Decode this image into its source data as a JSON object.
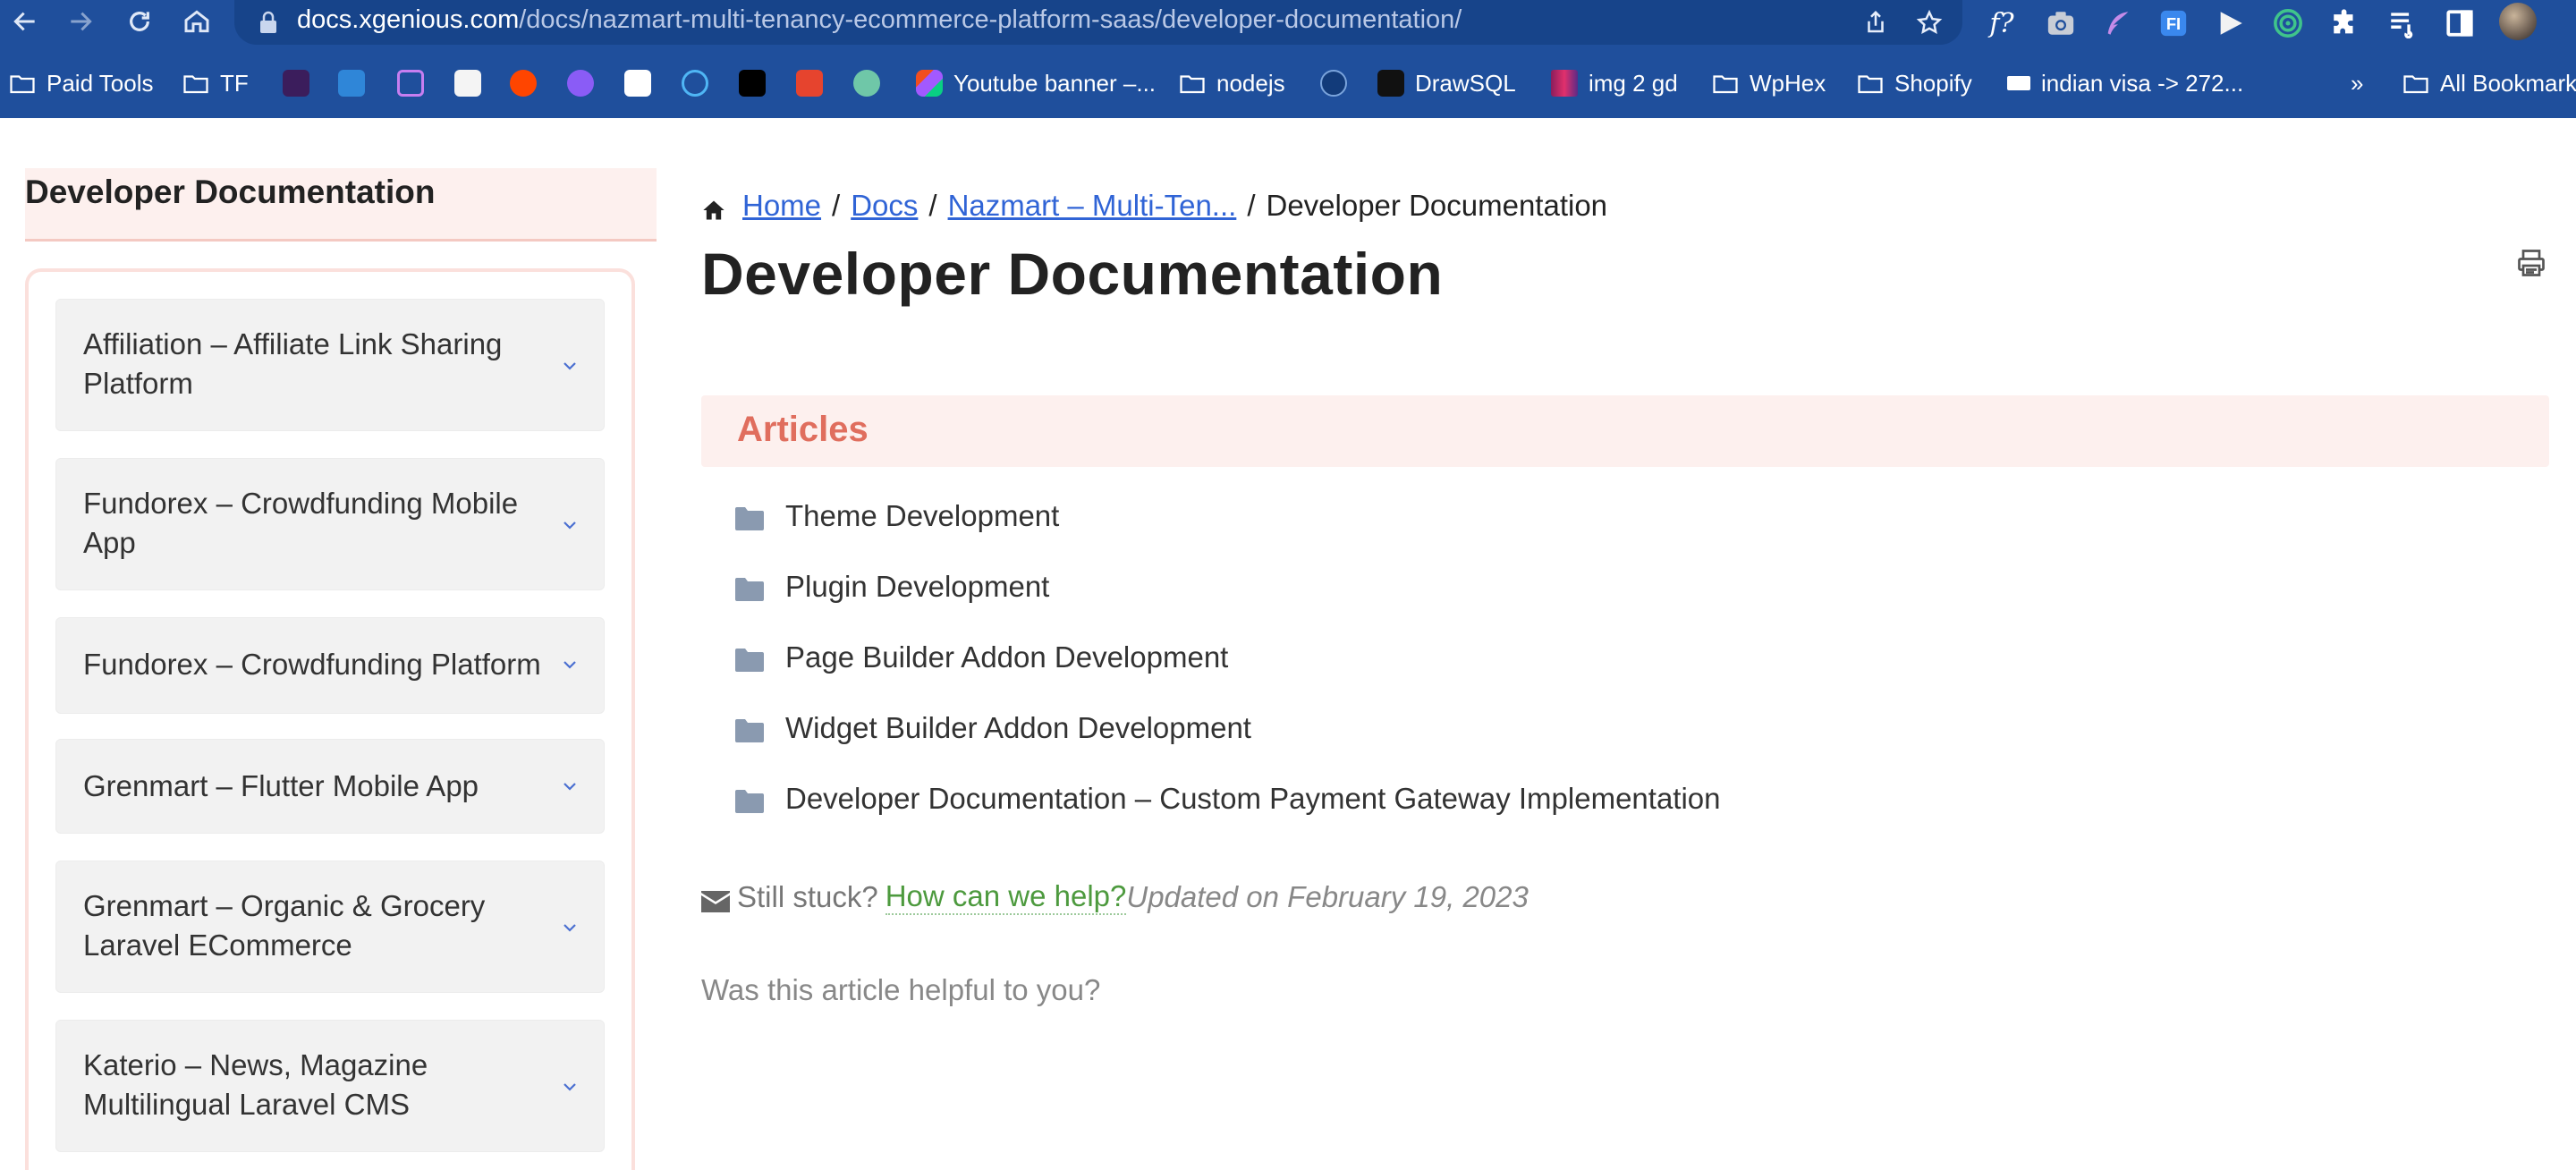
{
  "browser": {
    "url_host": "docs.xgenious.com",
    "url_path": "/docs/nazmart-multi-tenancy-ecommerce-platform-saas/developer-documentation/",
    "ext_f_label": "f?",
    "bookmarks": [
      {
        "label": "Paid Tools",
        "type": "folder"
      },
      {
        "label": "TF",
        "type": "folder"
      },
      {
        "label": "Youtube banner –...",
        "type": "site"
      },
      {
        "label": "nodejs",
        "type": "folder"
      },
      {
        "label": "DrawSQL",
        "type": "site"
      },
      {
        "label": "img 2 gd",
        "type": "site"
      },
      {
        "label": "WpHex",
        "type": "folder"
      },
      {
        "label": "Shopify",
        "type": "folder"
      },
      {
        "label": "indian visa -> 272...",
        "type": "site"
      },
      {
        "label": "»",
        "type": "overflow"
      },
      {
        "label": "All Bookmarks",
        "type": "folder"
      }
    ]
  },
  "sidebar": {
    "title": "Developer Documentation",
    "categories": [
      {
        "label": "Affiliation – Affiliate Link Sharing Platform"
      },
      {
        "label": "Fundorex – Crowdfunding Mobile App"
      },
      {
        "label": "Fundorex – Crowdfunding Platform"
      },
      {
        "label": "Grenmart – Flutter Mobile App"
      },
      {
        "label": "Grenmart – Organic & Grocery Laravel ECommerce"
      },
      {
        "label": "Katerio – News, Magazine Multilingual Laravel CMS"
      }
    ]
  },
  "breadcrumb": {
    "home": "Home",
    "docs": "Docs",
    "product": "Nazmart – Multi-Ten...",
    "current": "Developer Documentation",
    "separator": "/"
  },
  "main": {
    "title": "Developer Documentation",
    "articles_heading": "Articles",
    "articles": [
      "Theme Development",
      "Plugin Development",
      "Page Builder Addon Development",
      "Widget Builder Addon Development",
      "Developer Documentation – Custom Payment Gateway Implementation"
    ],
    "still_stuck": "Still stuck?",
    "help_link": "How can we help?",
    "updated": "Updated on February 19, 2023",
    "helpful_question": "Was this article helpful to you?"
  },
  "colors": {
    "chrome_bg": "#1f4f9c",
    "accent_link": "#3064d6",
    "articles_heading": "#e06e5e",
    "help_link": "#4d9a3e",
    "panel_bg": "#fdf0ee"
  }
}
